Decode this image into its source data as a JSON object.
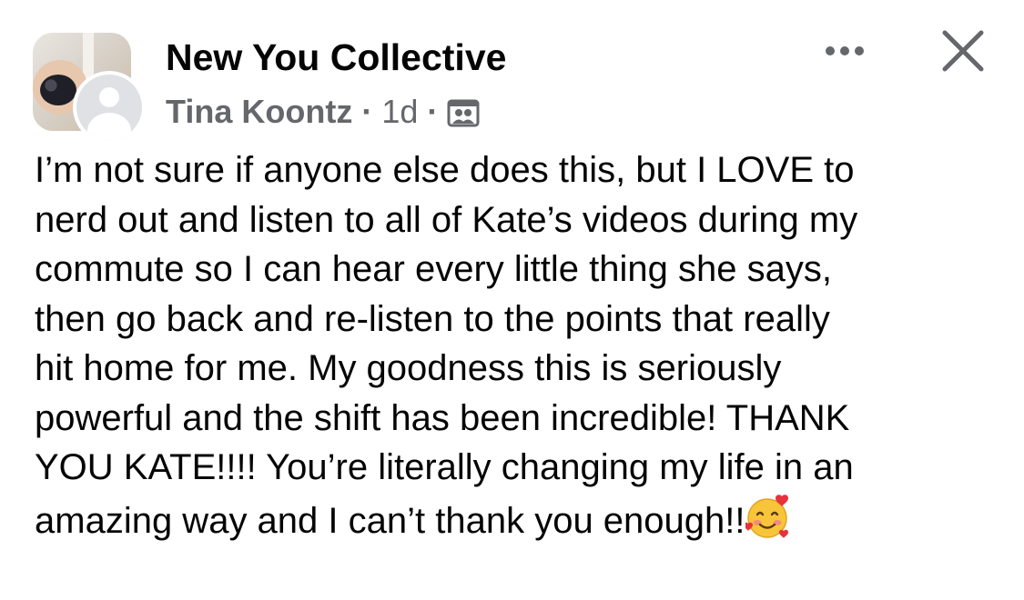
{
  "post": {
    "group_name": "New You Collective",
    "author": "Tina Koontz",
    "separator": "·",
    "time": "1d",
    "privacy_icon": "group-members-icon",
    "more_icon": "more-horizontal-icon",
    "close_icon": "close-icon",
    "body_lines": [
      "I’m not sure if anyone else does this, but I LOVE to",
      "nerd out and listen to all of Kate’s videos during my",
      "commute so I can hear every little thing she says,",
      "then go back and re-listen to the points that really",
      "hit home for me. My goodness this is seriously",
      "powerful and the shift has been incredible! THANK",
      "YOU KATE!!!! You’re literally changing my life in an",
      "amazing way and I can’t thank you enough!!"
    ],
    "trailing_emoji": "smiling-face-with-hearts-emoji"
  },
  "colors": {
    "primary_text": "#050505",
    "secondary_text": "#65676b",
    "background": "#ffffff"
  }
}
